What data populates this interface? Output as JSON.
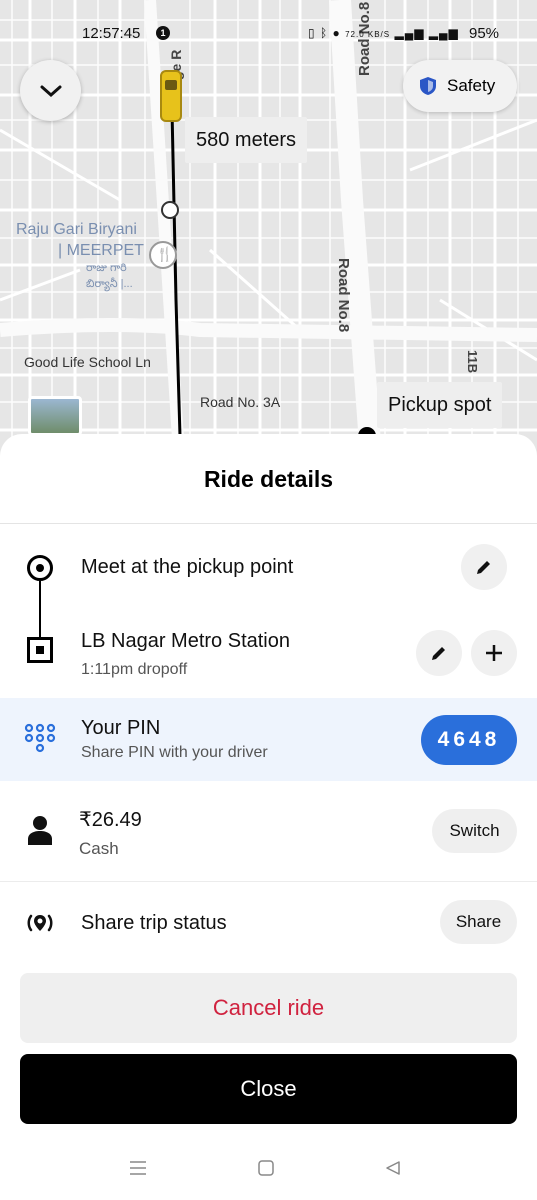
{
  "status_bar": {
    "time": "12:57:45",
    "notification_count": "1",
    "network_speed": "72.0 KB/S",
    "battery": "95%"
  },
  "map": {
    "street_labels": {
      "road_no8_top": "Road No.8",
      "road_ge": "ge R",
      "road_no8": "Road No.8",
      "road_11b": "11B",
      "road_3a": "Road No. 3A",
      "good_life": "Good Life School Ln"
    },
    "poi": {
      "name_line1": "Raju Gari Biryani",
      "name_line2": "| MEERPET",
      "local_line1": "రాజు గారి",
      "local_line2": "బిర్యానీ |..."
    },
    "distance_label": "580 meters",
    "pickup_label": "Pickup spot",
    "safety_label": "Safety",
    "route_marker": "6"
  },
  "sheet": {
    "title": "Ride details",
    "pickup": {
      "title": "Meet at the pickup point"
    },
    "dropoff": {
      "title": "LB Nagar Metro Station",
      "eta": "1:11pm dropoff"
    },
    "pin": {
      "title": "Your PIN",
      "subtitle": "Share PIN with your driver",
      "value": "4648"
    },
    "payment": {
      "amount": "₹26.49",
      "method": "Cash",
      "switch_label": "Switch"
    },
    "share": {
      "title": "Share trip status",
      "share_label": "Share"
    },
    "cancel_label": "Cancel ride",
    "close_label": "Close"
  },
  "colors": {
    "pin_accent": "#2a6fdb",
    "pin_row_bg": "#eef4fd",
    "cancel_text": "#d0223f",
    "route_line": "#000000",
    "car": "#e7c21b"
  }
}
